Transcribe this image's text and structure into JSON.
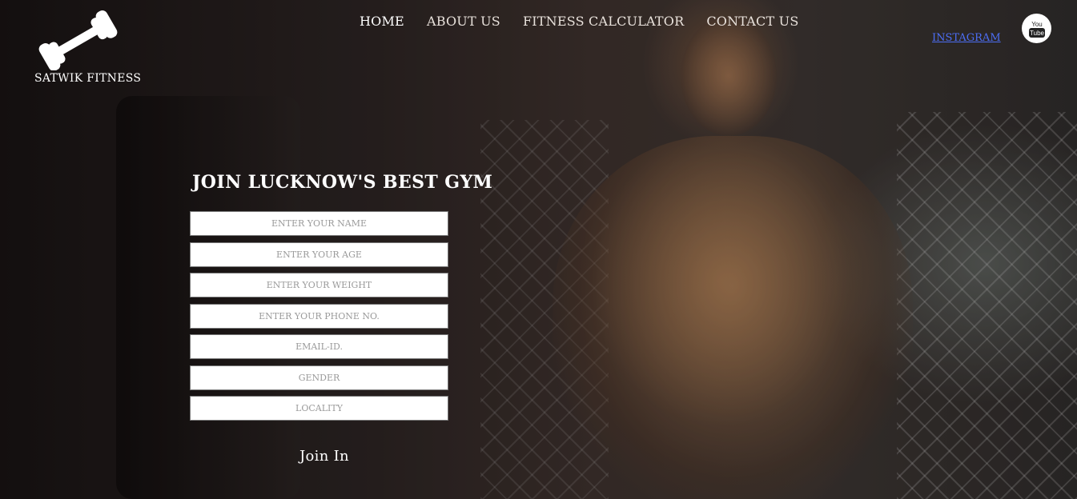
{
  "brand": {
    "name": "SATWIK FITNESS",
    "logo_icon": "dumbbell-icon"
  },
  "nav": {
    "items": [
      {
        "label": "HOME",
        "active": true
      },
      {
        "label": "ABOUT US",
        "active": false
      },
      {
        "label": "FITNESS CALCULATOR",
        "active": false
      },
      {
        "label": "CONTACT US",
        "active": false
      }
    ]
  },
  "social": {
    "instagram_alt": "INSTAGRAM",
    "youtube_icon": "youtube-icon",
    "youtube_label_top": "You",
    "youtube_label_bottom": "Tube"
  },
  "form": {
    "title": "JOIN LUCKNOW'S BEST GYM",
    "fields": {
      "name": "ENTER YOUR NAME",
      "age": "ENTER YOUR AGE",
      "weight": "ENTER YOUR WEIGHT",
      "phone": "ENTER YOUR PHONE NO.",
      "email": "EMAIL-ID.",
      "gender": "GENDER",
      "locality": "LOCALITY"
    },
    "submit_label": "Join In"
  },
  "colors": {
    "text": "#ffffff",
    "link": "#4c6ef5",
    "background": "#1f1a19"
  }
}
